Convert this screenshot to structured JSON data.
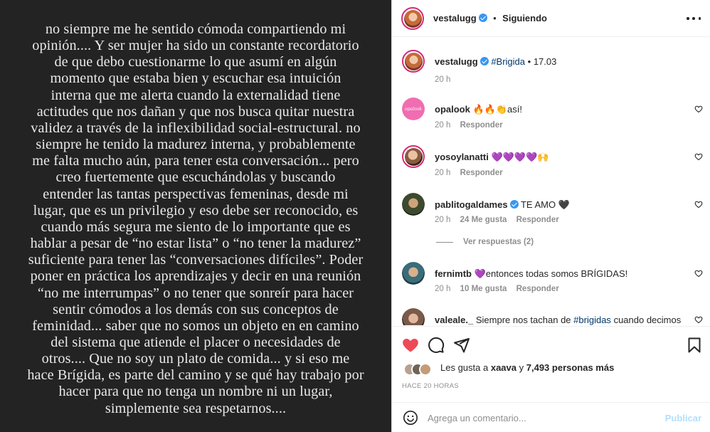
{
  "post": {
    "lines": [
      "no siempre me he sentido cómoda compartiendo mi",
      "opinión.... Y ser mujer ha sido un constante recordatorio",
      "de que debo cuestionarme lo que asumí en algún",
      "momento que estaba bien y escuchar esa intuición",
      "interna que me alerta cuando la externalidad tiene",
      "actitudes que nos dañan y que nos busca quitar nuestra",
      "validez a través de la inflexibilidad social-estructural. no",
      "siempre he tenido la madurez interna, y probablemente",
      "me falta mucho aún, para tener esta conversación... pero",
      "creo fuertemente que escuchándolas y buscando",
      "entender las tantas perspectivas femeninas, desde mi",
      "lugar, que es un privilegio y eso debe ser reconocido, es",
      "cuando más segura me siento de lo importante que es",
      "hablar a pesar de “no estar lista” o “no tener la madurez”",
      "suficiente para tener las “conversaciones difíciles”. Poder",
      "poner en práctica los aprendizajes y decir en una reunión",
      "“no me interrumpas” o no tener que sonreír para hacer",
      "sentir cómodos a los demás con sus conceptos de",
      "feminidad... saber que no somos un objeto en en camino",
      "del sistema que atiende el placer o necesidades de",
      "otros.... Que no soy un plato de comida... y si eso me",
      "hace Brígida, es parte del camino y se qué hay trabajo por",
      "hacer para que no tenga un nombre ni un lugar,",
      "simplemente sea respetarnos...."
    ]
  },
  "header": {
    "username": "vestalugg",
    "separator": "•",
    "follow_status": "Siguiendo"
  },
  "caption": {
    "username": "vestalugg",
    "hashtag": "#Brigida",
    "separator": "•",
    "date": "17.03",
    "time": "20 h"
  },
  "comments": [
    {
      "username": "opalook",
      "text": "🔥🔥👏así!",
      "time": "20 h",
      "likes": "",
      "reply": "Responder"
    },
    {
      "username": "yosoylanatti",
      "text": "💜💜💜💜🙌",
      "time": "20 h",
      "likes": "",
      "reply": "Responder"
    },
    {
      "username": "pablitogaldames",
      "text": "TE AMO 🖤",
      "time": "20 h",
      "likes": "24 Me gusta",
      "reply": "Responder",
      "view_replies": "Ver respuestas (2)"
    },
    {
      "username": "fernimtb",
      "text": "💜entonces todas somos BRÍGIDAS!",
      "time": "20 h",
      "likes": "10 Me gusta",
      "reply": "Responder"
    },
    {
      "username": "valeale._",
      "text_before": "Siempre nos tachan de",
      "hashtag": "#brigidas",
      "text_after": "cuando decimos"
    }
  ],
  "likes": {
    "prefix": "Les gusta a",
    "user": "xaava",
    "middle": "y",
    "count_text": "7,493 personas más"
  },
  "time_ago": "HACE 20 HORAS",
  "comment_box": {
    "placeholder": "Agrega un comentario...",
    "publish_label": "Publicar"
  },
  "colors": {
    "post_bg": "#232323",
    "post_text": "#e9e9e9",
    "liked_heart": "#ed4956",
    "verified": "#3897f0",
    "publish_disabled": "#b2dffc",
    "meta": "#8e8e8e"
  },
  "icons": [
    "verified-badge-icon",
    "more-options-icon",
    "heart-icon",
    "comment-icon",
    "share-icon",
    "bookmark-icon",
    "emoji-icon"
  ]
}
